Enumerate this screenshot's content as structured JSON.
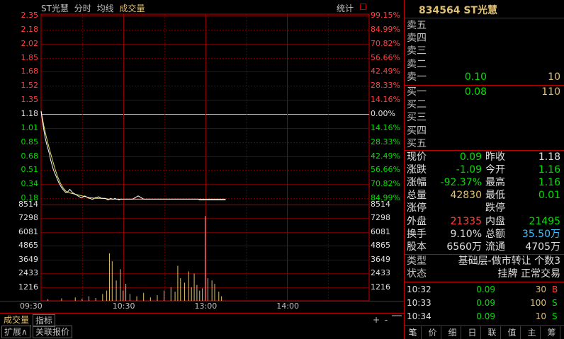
{
  "chart_header": {
    "name": "ST光慧",
    "mode": "分时",
    "avg_label": "均线",
    "vol_label": "成交量",
    "stats_label": "统计"
  },
  "chart_data": {
    "type": "line",
    "price_axis": {
      "labels": [
        "2.35",
        "2.18",
        "2.02",
        "1.85",
        "1.68",
        "1.52",
        "1.35",
        "1.18",
        "1.01",
        "0.85",
        "0.68",
        "0.51",
        "0.34",
        "0.18"
      ],
      "pct_labels": [
        "99.15%",
        "84.99%",
        "70.82%",
        "56.66%",
        "42.49%",
        "28.33%",
        "14.16%",
        "0.00%",
        "14.16%",
        "28.33%",
        "42.49%",
        "56.66%",
        "70.82%",
        "84.99%"
      ],
      "ylim": [
        0.06,
        2.35
      ],
      "base": 1.18
    },
    "volume_axis": {
      "labels": [
        "8514",
        "7298",
        "6081",
        "4865",
        "3649",
        "2433",
        "1216"
      ],
      "ylim": [
        0,
        8514
      ]
    },
    "time_axis": {
      "labels": [
        "09:30",
        "10:30",
        "13:00",
        "14:00"
      ],
      "total_minutes": 240
    },
    "price_series": {
      "name": "分时",
      "x": [
        0,
        1,
        2,
        3,
        4,
        5,
        6,
        7,
        8,
        9,
        10,
        11,
        12,
        13,
        14,
        15,
        16,
        17,
        18,
        19,
        20,
        21,
        22,
        23,
        24,
        25,
        26,
        27,
        28,
        29,
        30,
        31,
        32,
        33,
        34,
        35,
        36,
        37,
        38,
        39,
        40,
        41,
        42,
        43,
        44,
        45,
        46,
        47,
        48,
        49,
        50,
        51,
        52,
        53,
        54,
        55,
        56,
        57,
        58,
        59,
        60,
        61,
        62,
        63,
        64,
        65,
        66,
        67,
        68,
        69,
        70,
        71,
        72,
        73,
        74,
        75,
        76,
        77,
        78,
        79,
        80,
        81,
        82,
        83,
        84,
        85,
        86,
        87,
        88,
        89,
        90,
        91,
        92,
        93,
        94,
        95,
        96,
        97,
        98,
        99,
        100,
        101,
        102,
        103,
        104,
        105,
        106,
        107,
        108,
        109,
        110,
        111,
        112,
        113,
        114,
        115,
        116,
        117,
        118,
        119,
        120,
        121,
        122,
        123,
        124,
        125,
        126,
        127,
        128,
        129,
        130,
        131,
        132,
        133,
        134,
        135
      ],
      "values": [
        1.18,
        1.05,
        0.95,
        0.85,
        0.78,
        0.72,
        0.66,
        0.58,
        0.52,
        0.46,
        0.42,
        0.38,
        0.34,
        0.3,
        0.27,
        0.24,
        0.22,
        0.2,
        0.18,
        0.18,
        0.2,
        0.22,
        0.2,
        0.18,
        0.17,
        0.16,
        0.15,
        0.14,
        0.13,
        0.12,
        0.12,
        0.13,
        0.14,
        0.13,
        0.12,
        0.11,
        0.11,
        0.1,
        0.1,
        0.11,
        0.12,
        0.12,
        0.13,
        0.12,
        0.11,
        0.11,
        0.11,
        0.11,
        0.1,
        0.09,
        0.1,
        0.11,
        0.1,
        0.1,
        0.11,
        0.1,
        0.1,
        0.09,
        0.1,
        0.1,
        0.1,
        0.1,
        0.1,
        0.1,
        0.1,
        0.1,
        0.1,
        0.1,
        0.11,
        0.12,
        0.13,
        0.14,
        0.13,
        0.12,
        0.11,
        0.1,
        0.1,
        0.1,
        0.1,
        0.1,
        0.1,
        0.1,
        0.1,
        0.1,
        0.1,
        0.1,
        0.1,
        0.1,
        0.1,
        0.1,
        0.1,
        0.1,
        0.1,
        0.1,
        0.1,
        0.1,
        0.1,
        0.1,
        0.1,
        0.1,
        0.1,
        0.1,
        0.1,
        0.1,
        0.1,
        0.1,
        0.1,
        0.1,
        0.1,
        0.1,
        0.1,
        0.1,
        0.1,
        0.1,
        0.1,
        0.1,
        0.09,
        0.09,
        0.09,
        0.09,
        0.09,
        0.09,
        0.09,
        0.09,
        0.09,
        0.09,
        0.09,
        0.09,
        0.09,
        0.09,
        0.09,
        0.09,
        0.09,
        0.09,
        0.09,
        0.09
      ]
    },
    "avg_series": {
      "name": "均线",
      "x": [
        0,
        2,
        4,
        6,
        8,
        10,
        12,
        14,
        16,
        18,
        20,
        25,
        30,
        35,
        40,
        45,
        50,
        55,
        60,
        70,
        80,
        90,
        100,
        110,
        120,
        135
      ],
      "values": [
        1.18,
        1.0,
        0.85,
        0.72,
        0.6,
        0.48,
        0.38,
        0.3,
        0.24,
        0.2,
        0.18,
        0.16,
        0.14,
        0.12,
        0.11,
        0.11,
        0.1,
        0.1,
        0.1,
        0.1,
        0.1,
        0.1,
        0.1,
        0.1,
        0.1,
        0.1
      ]
    },
    "volume_series": {
      "name": "成交量",
      "x": [
        5,
        15,
        25,
        30,
        35,
        40,
        45,
        48,
        50,
        52,
        55,
        58,
        60,
        62,
        65,
        70,
        75,
        80,
        85,
        90,
        95,
        98,
        100,
        102,
        105,
        108,
        110,
        112,
        114,
        116,
        118,
        120,
        122,
        125,
        127,
        130,
        132
      ],
      "values": [
        150,
        220,
        300,
        180,
        400,
        250,
        600,
        900,
        4200,
        3500,
        1800,
        2800,
        900,
        1500,
        600,
        400,
        700,
        300,
        500,
        900,
        1200,
        800,
        3100,
        2000,
        1600,
        2600,
        1200,
        2400,
        1400,
        900,
        1100,
        7500,
        2000,
        1800,
        1500,
        800,
        400
      ]
    }
  },
  "bottom_tabs": {
    "volume": "成交量",
    "indicator": "指标",
    "expand": "扩展∧",
    "related": "关联报价",
    "plus": "+",
    "minus": "-",
    "close": "□"
  },
  "stock": {
    "code_name": "834564 ST光慧"
  },
  "order_book": {
    "asks": [
      {
        "label": "卖五",
        "price": "",
        "qty": ""
      },
      {
        "label": "卖四",
        "price": "",
        "qty": ""
      },
      {
        "label": "卖三",
        "price": "",
        "qty": ""
      },
      {
        "label": "卖二",
        "price": "",
        "qty": ""
      },
      {
        "label": "卖一",
        "price": "0.10",
        "qty": "10"
      }
    ],
    "bids": [
      {
        "label": "买一",
        "price": "0.08",
        "qty": "110"
      },
      {
        "label": "买二",
        "price": "",
        "qty": ""
      },
      {
        "label": "买三",
        "price": "",
        "qty": ""
      },
      {
        "label": "买四",
        "price": "",
        "qty": ""
      },
      {
        "label": "买五",
        "price": "",
        "qty": ""
      }
    ]
  },
  "quote": [
    {
      "k1": "现价",
      "v1": "0.09",
      "c1": "g",
      "k2": "昨收",
      "v2": "1.18",
      "c2": "w"
    },
    {
      "k1": "涨跌",
      "v1": "-1.09",
      "c1": "g",
      "k2": "今开",
      "v2": "1.16",
      "c2": "g"
    },
    {
      "k1": "涨幅",
      "v1": "-92.37%",
      "c1": "g",
      "k2": "最高",
      "v2": "1.16",
      "c2": "g"
    },
    {
      "k1": "总量",
      "v1": "42830",
      "c1": "y",
      "k2": "最低",
      "v2": "0.01",
      "c2": "g"
    },
    {
      "k1": "涨停",
      "v1": "",
      "c1": "w",
      "k2": "跌停",
      "v2": "",
      "c2": "w"
    },
    {
      "k1": "外盘",
      "v1": "21335",
      "c1": "r",
      "k2": "内盘",
      "v2": "21495",
      "c2": "g"
    },
    {
      "k1": "换手",
      "v1": "9.10%",
      "c1": "w",
      "k2": "总额",
      "v2": "35.50万",
      "c2": "c"
    },
    {
      "k1": "股本",
      "v1": "6560万",
      "c1": "w",
      "k2": "流通",
      "v2": "4705万",
      "c2": "w"
    }
  ],
  "info": {
    "type_label": "类型",
    "type_value": "基础层-做市转让 个数3",
    "status_label": "状态",
    "status_value": "挂牌 正常交易"
  },
  "trades": [
    {
      "time": "10:32",
      "price": "0.09",
      "vol": "30",
      "dir": "B",
      "dir_color": "r"
    },
    {
      "time": "10:33",
      "price": "0.09",
      "vol": "100",
      "dir": "S",
      "dir_color": "g"
    },
    {
      "time": "10:34",
      "price": "0.09",
      "vol": "10",
      "dir": "S",
      "dir_color": "g"
    }
  ],
  "panel_tabs": [
    "笔",
    "价",
    "细",
    "日",
    "联",
    "值",
    "主",
    "筹"
  ],
  "colors": {
    "grid": "#8b0000",
    "frame": "#c00000",
    "price_line": "#ffffff",
    "avg_line": "#e0e060",
    "volume_bar": "#e0c070",
    "up": "#ff4040",
    "down": "#00e000"
  }
}
